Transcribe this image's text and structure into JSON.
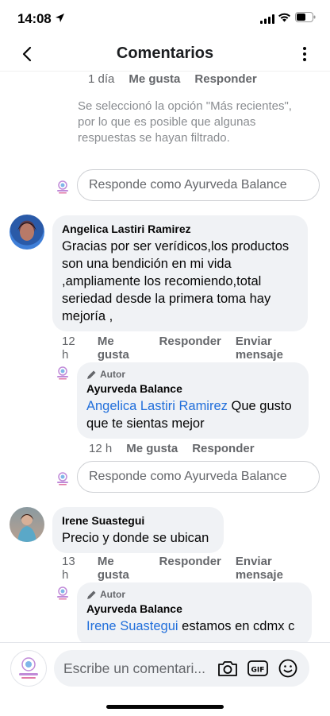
{
  "status_bar": {
    "time": "14:08"
  },
  "nav": {
    "title": "Comentarios"
  },
  "thread": {
    "top_meta": {
      "time": "1 día",
      "like": "Me gusta",
      "reply": "Responder"
    },
    "notice": "Se seleccionó la opción \"Más recientes\", por lo que es posible que algunas respuestas se hayan filtrado.",
    "reply_placeholder_1": "Responde como Ayurveda Balance"
  },
  "comments": [
    {
      "author": "Angelica Lastiri Ramirez",
      "text": "Gracias por ser verídicos,los productos son una bendición en mi vida ,ampliamente los recomiendo,total seriedad desde la primera toma hay mejoría ,",
      "time": "12 h",
      "like": "Me gusta",
      "reply": "Responder",
      "message": "Enviar mensaje",
      "reply_item": {
        "tag": "Autor",
        "author": "Ayurveda Balance",
        "mention": "Angelica Lastiri Ramirez",
        "text": " Que gusto que te sientas mejor",
        "time": "12 h",
        "like": "Me gusta",
        "reply": "Responder"
      },
      "reply_placeholder": "Responde como Ayurveda Balance"
    },
    {
      "author": "Irene Suastegui",
      "text": "Precio y donde se ubican",
      "time": "13 h",
      "like": "Me gusta",
      "reply": "Responder",
      "message": "Enviar mensaje",
      "reply_item": {
        "tag": "Autor",
        "author": "Ayurveda Balance",
        "mention": "Irene Suastegui",
        "text": " estamos en cdmx c"
      }
    }
  ],
  "composer": {
    "placeholder": "Escribe un comentari..."
  },
  "colors": {
    "link": "#216fdb",
    "bubble": "#f0f2f5",
    "meta": "#65676b"
  }
}
